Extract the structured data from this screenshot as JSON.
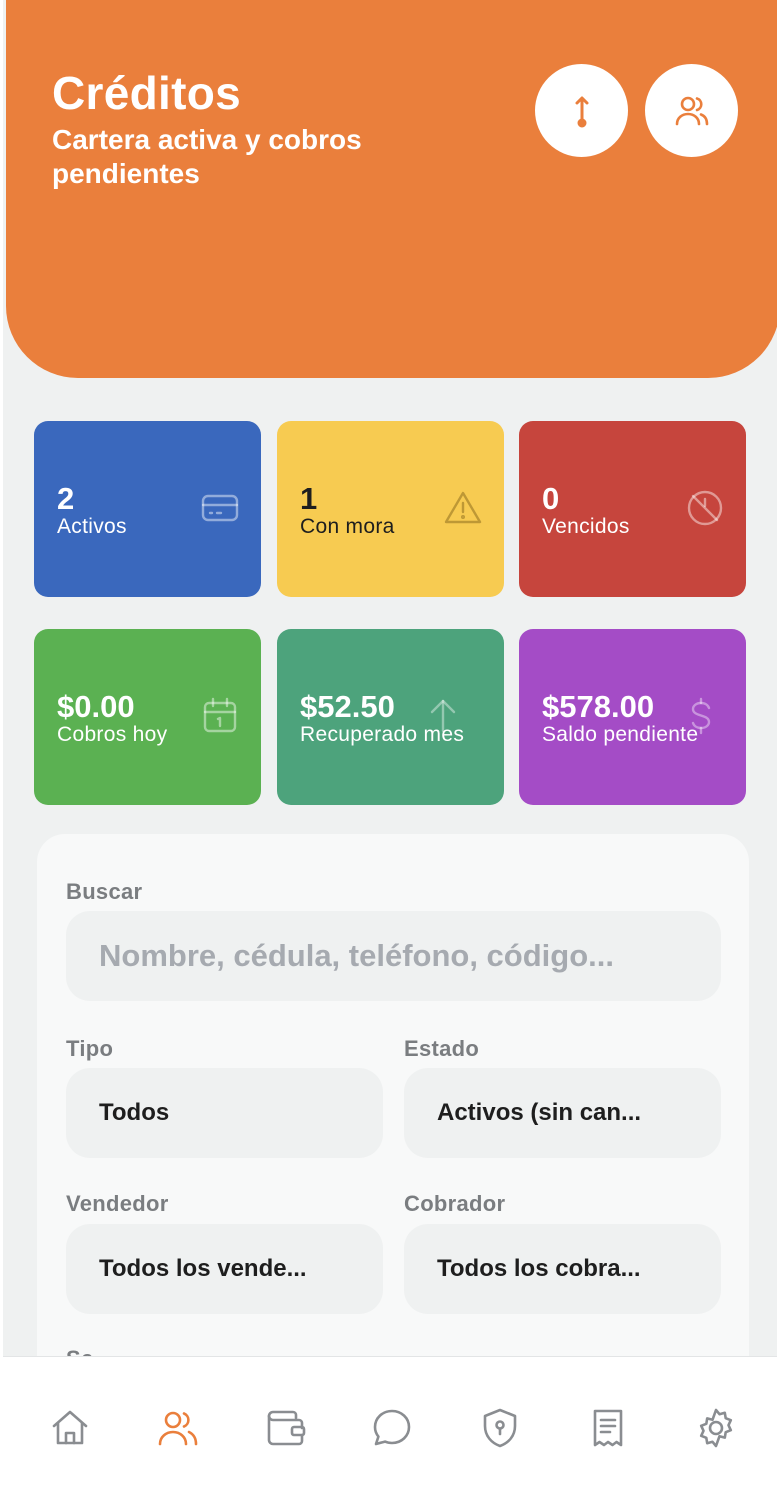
{
  "header": {
    "title": "Créditos",
    "subtitle": "Cartera activa y cobros pendientes",
    "buttons": [
      {
        "icon": "sort-vertical-icon"
      },
      {
        "icon": "users-icon"
      }
    ],
    "color": "#ea7f3c"
  },
  "stats": [
    {
      "value": "2",
      "label": "Activos",
      "icon": "credit-card-icon",
      "color": "#3a68bd"
    },
    {
      "value": "1",
      "label": "Con mora",
      "icon": "warning-triangle-icon",
      "color": "#f7cb51"
    },
    {
      "value": "0",
      "label": "Vencidos",
      "icon": "clock-off-icon",
      "color": "#c6453d"
    },
    {
      "value": "$0.00",
      "label": "Cobros hoy",
      "icon": "calendar-icon",
      "color": "#5bb152"
    },
    {
      "value": "$52.50",
      "label": "Recuperado mes",
      "icon": "arrow-up-icon",
      "color": "#4da37c"
    },
    {
      "value": "$578.00",
      "label": "Saldo pendiente",
      "icon": "dollar-icon",
      "color": "#a44cc6"
    }
  ],
  "filters": {
    "search": {
      "label": "Buscar",
      "placeholder": "Nombre, cédula, teléfono, código..."
    },
    "tipo": {
      "label": "Tipo",
      "value": "Todos"
    },
    "estado": {
      "label": "Estado",
      "value": "Activos (sin can..."
    },
    "vendedor": {
      "label": "Vendedor",
      "value": "Todos los vende..."
    },
    "cobrador": {
      "label": "Cobrador",
      "value": "Todos los cobra..."
    },
    "partial_label": "Se..."
  },
  "nav": {
    "items": [
      {
        "icon": "home-icon",
        "active": false
      },
      {
        "icon": "users-icon",
        "active": true
      },
      {
        "icon": "wallet-icon",
        "active": false
      },
      {
        "icon": "chat-bubble-icon",
        "active": false
      },
      {
        "icon": "shield-lock-icon",
        "active": false
      },
      {
        "icon": "receipt-icon",
        "active": false
      },
      {
        "icon": "settings-gear-icon",
        "active": false
      }
    ],
    "active_color": "#ea7f3c",
    "inactive_color": "#8a8d91"
  }
}
